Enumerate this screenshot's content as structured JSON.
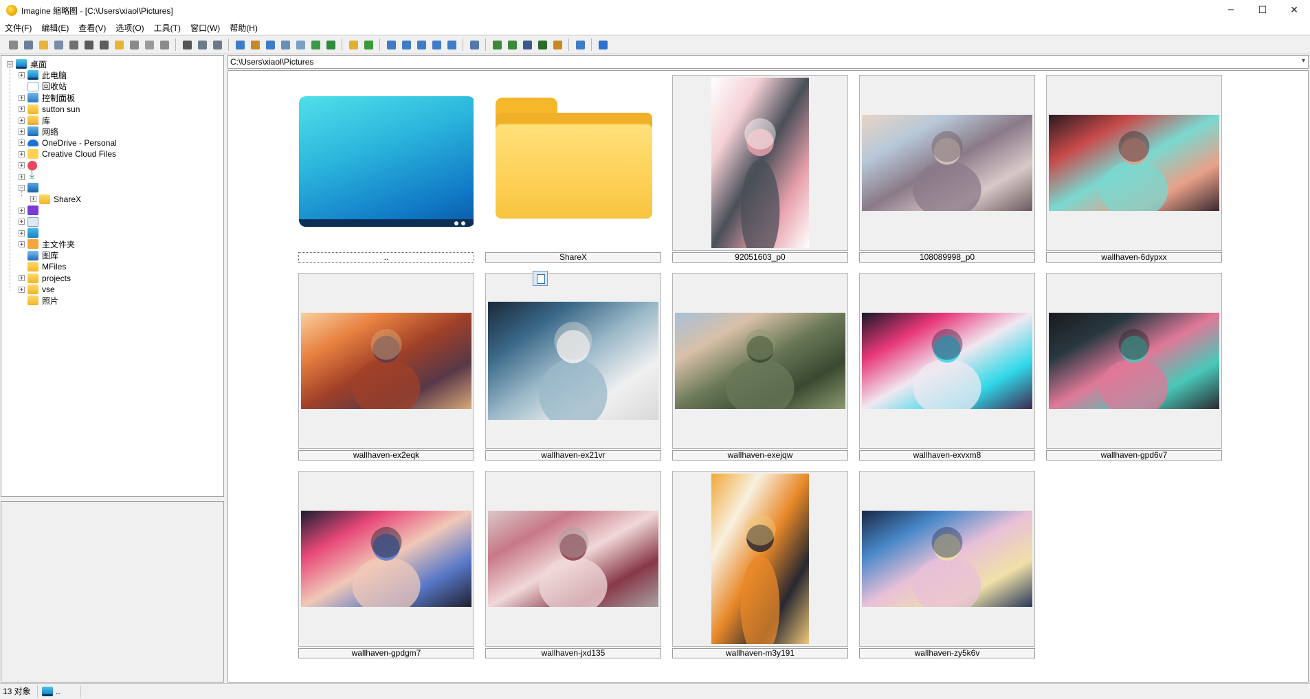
{
  "window": {
    "title": "Imagine 缩略图 - [C:\\Users\\xiaol\\Pictures]",
    "minimize": "─",
    "maximize": "☐",
    "close": "✕"
  },
  "menu": [
    "文件(F)",
    "编辑(E)",
    "查看(V)",
    "选项(O)",
    "工具(T)",
    "窗口(W)",
    "帮助(H)"
  ],
  "toolbar": {
    "groups": [
      [
        {
          "icon": "eye-icon",
          "color": "#8a8a8a"
        },
        {
          "icon": "view-icon",
          "color": "#6a7f99"
        },
        {
          "icon": "open-folder-icon",
          "color": "#e8b33a"
        },
        {
          "icon": "copy-window-icon",
          "color": "#7a8ca8"
        },
        {
          "icon": "print-icon",
          "color": "#707070"
        },
        {
          "icon": "info-icon",
          "color": "#5a5a5a"
        },
        {
          "icon": "camera-icon",
          "color": "#5e5e5e"
        },
        {
          "icon": "new-folder-icon",
          "color": "#e8b33a"
        },
        {
          "icon": "rename-icon",
          "color": "#8a8a8a"
        },
        {
          "icon": "delete-icon",
          "color": "#9a9a9a"
        },
        {
          "icon": "properties-icon",
          "color": "#8a8a8a"
        }
      ],
      [
        {
          "icon": "cut-icon",
          "color": "#555555"
        },
        {
          "icon": "copy-icon",
          "color": "#6d7a8c"
        },
        {
          "icon": "paste-icon",
          "color": "#6d7a8c"
        }
      ],
      [
        {
          "icon": "thumbnail-view-icon",
          "color": "#3e7cc7"
        },
        {
          "icon": "details-view-icon",
          "color": "#c58a2b"
        },
        {
          "icon": "refresh-icon",
          "color": "#3e7cc7"
        },
        {
          "icon": "select-all-icon",
          "color": "#6a8fb8"
        },
        {
          "icon": "grid-icon",
          "color": "#7aa0c8"
        },
        {
          "icon": "filter-icon",
          "color": "#3a9a4a"
        },
        {
          "icon": "slideshow-icon",
          "color": "#2f8a3e"
        }
      ],
      [
        {
          "icon": "folder-up-icon",
          "color": "#e0b030"
        },
        {
          "icon": "sync-icon",
          "color": "#3a9a3a"
        }
      ],
      [
        {
          "icon": "large-icons-icon",
          "color": "#3e7cc7"
        },
        {
          "icon": "medium-icons-icon",
          "color": "#3e7cc7"
        },
        {
          "icon": "small-icons-icon",
          "color": "#3e7cc7"
        },
        {
          "icon": "list-icon",
          "color": "#3e7cc7"
        },
        {
          "icon": "report-icon",
          "color": "#3e7cc7"
        }
      ],
      [
        {
          "icon": "wrench-icon",
          "color": "#5577aa"
        }
      ],
      [
        {
          "icon": "search-icon",
          "color": "#3a8a3a"
        },
        {
          "icon": "batch-icon",
          "color": "#3a8a3a"
        },
        {
          "icon": "monitor-icon",
          "color": "#3a5a8a"
        },
        {
          "icon": "film-icon",
          "color": "#2a6a2a"
        },
        {
          "icon": "convert-icon",
          "color": "#c88a20"
        }
      ],
      [
        {
          "icon": "edit-icon",
          "color": "#3e7cc7"
        }
      ],
      [
        {
          "icon": "help-icon",
          "color": "#2f6fd0"
        }
      ]
    ]
  },
  "tree": [
    {
      "label": "桌面",
      "icon": "monitor",
      "level": 0,
      "expander": "−"
    },
    {
      "label": "此电脑",
      "icon": "monitor",
      "level": 1,
      "expander": "+"
    },
    {
      "label": "回收站",
      "icon": "recycle",
      "level": 1,
      "expander": ""
    },
    {
      "label": "控制面板",
      "icon": "control",
      "level": 1,
      "expander": "+"
    },
    {
      "label": "sutton sun",
      "icon": "folder",
      "level": 1,
      "expander": "+"
    },
    {
      "label": "库",
      "icon": "library",
      "level": 1,
      "expander": "+"
    },
    {
      "label": "网络",
      "icon": "network",
      "level": 1,
      "expander": "+"
    },
    {
      "label": "OneDrive - Personal",
      "icon": "cloud",
      "level": 1,
      "expander": "+"
    },
    {
      "label": "Creative Cloud Files",
      "icon": "cc",
      "level": 1,
      "expander": "+"
    },
    {
      "label": "",
      "icon": "music",
      "level": 1,
      "expander": "+"
    },
    {
      "label": "",
      "icon": "download",
      "level": 1,
      "expander": "+"
    },
    {
      "label": "",
      "icon": "pictures",
      "level": 1,
      "expander": "−"
    },
    {
      "label": "ShareX",
      "icon": "folder",
      "level": 2,
      "expander": "+"
    },
    {
      "label": "",
      "icon": "video",
      "level": 1,
      "expander": "+"
    },
    {
      "label": "",
      "icon": "doc",
      "level": 1,
      "expander": "+"
    },
    {
      "label": "",
      "icon": "desktop2",
      "level": 1,
      "expander": "+"
    },
    {
      "label": "主文件夹",
      "icon": "home",
      "level": 1,
      "expander": "+"
    },
    {
      "label": "图库",
      "icon": "gallery",
      "level": 1,
      "expander": ""
    },
    {
      "label": "MFiles",
      "icon": "folder",
      "level": 1,
      "expander": ""
    },
    {
      "label": "projects",
      "icon": "folder",
      "level": 1,
      "expander": "+"
    },
    {
      "label": "vse",
      "icon": "folder",
      "level": 1,
      "expander": "+"
    },
    {
      "label": "照片",
      "icon": "folder",
      "level": 1,
      "expander": ""
    }
  ],
  "path": "C:\\Users\\xiaol\\Pictures",
  "thumbnails": [
    {
      "caption": "..",
      "kind": "desktop"
    },
    {
      "caption": "ShareX",
      "kind": "folder"
    },
    {
      "caption": "92051603_p0",
      "kind": "image",
      "orient": "portrait",
      "colors": [
        "#ffffff",
        "#f4d0d6",
        "#4a4f58",
        "#e7a0ab",
        "#ffffff"
      ]
    },
    {
      "caption": "108089998_p0",
      "kind": "image",
      "orient": "landscape",
      "colors": [
        "#e8d4c4",
        "#b8c8d8",
        "#8a7a88",
        "#d8c8c8",
        "#6a5a5e"
      ]
    },
    {
      "caption": "wallhaven-6dypxx",
      "kind": "image",
      "orient": "landscape",
      "colors": [
        "#2a1a20",
        "#c84a4a",
        "#7ad8d0",
        "#e8a088",
        "#3a2a30"
      ]
    },
    {
      "caption": "wallhaven-ex2eqk",
      "kind": "image",
      "orient": "landscape",
      "colors": [
        "#f8d0a0",
        "#e88040",
        "#a04028",
        "#583848",
        "#d8a878"
      ]
    },
    {
      "caption": "wallhaven-ex21vr",
      "kind": "image",
      "orient": "landscape",
      "colors": [
        "#1a2838",
        "#3a6888",
        "#9ab8c8",
        "#f0f0f0",
        "#d8d8d8"
      ]
    },
    {
      "caption": "wallhaven-exejqw",
      "kind": "image",
      "orient": "landscape",
      "colors": [
        "#a8c0d8",
        "#d8c0a8",
        "#6a7858",
        "#3a4830",
        "#8a9a70"
      ]
    },
    {
      "caption": "wallhaven-exvxm8",
      "kind": "image",
      "orient": "landscape",
      "colors": [
        "#181828",
        "#e83878",
        "#f0e8f0",
        "#30d8e8",
        "#402850"
      ]
    },
    {
      "caption": "wallhaven-gpd6v7",
      "kind": "image",
      "orient": "landscape",
      "colors": [
        "#1a1a1e",
        "#283840",
        "#e07898",
        "#48c8b8",
        "#2a2a30"
      ]
    },
    {
      "caption": "wallhaven-gpdgm7",
      "kind": "image",
      "orient": "landscape",
      "colors": [
        "#1a1e30",
        "#e84878",
        "#f0c8b8",
        "#5878c8",
        "#202030"
      ]
    },
    {
      "caption": "wallhaven-jxd135",
      "kind": "image",
      "orient": "landscape",
      "colors": [
        "#d8c8c8",
        "#c87888",
        "#f0d8d8",
        "#883848",
        "#a8a0a0"
      ]
    },
    {
      "caption": "wallhaven-m3y191",
      "kind": "image",
      "orient": "portrait",
      "colors": [
        "#f0a838",
        "#f8f0e0",
        "#e88828",
        "#282830",
        "#f0c878"
      ]
    },
    {
      "caption": "wallhaven-zy5k6v",
      "kind": "image",
      "orient": "landscape",
      "colors": [
        "#1a2848",
        "#4888c8",
        "#e8c0d8",
        "#f0e0a8",
        "#283858"
      ]
    }
  ],
  "status": {
    "count": "13 对象",
    "selection": ".."
  }
}
